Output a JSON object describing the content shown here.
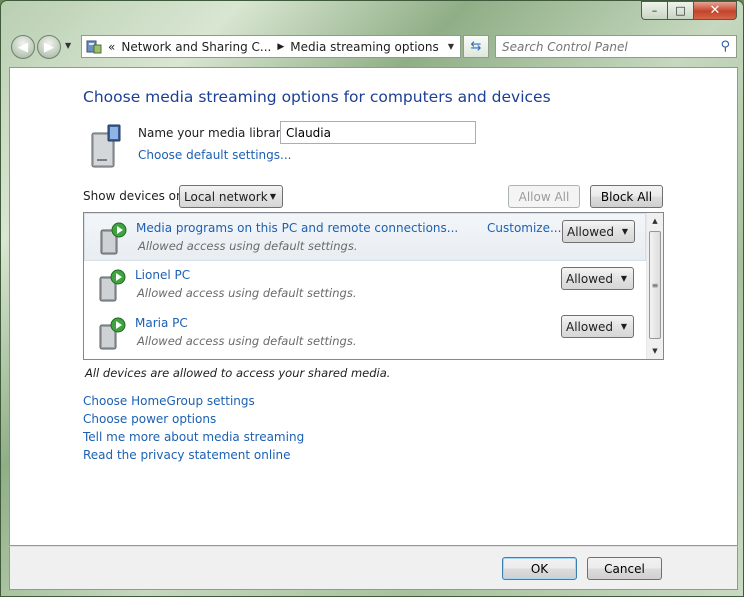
{
  "window": {
    "caption_buttons": {
      "minimize": "–",
      "maximize": "□",
      "close": "✕"
    }
  },
  "nav": {
    "back_icon": "back-arrow-icon",
    "forward_icon": "forward-arrow-icon",
    "breadcrumb_prefix": "«",
    "breadcrumbs": [
      "Network and Sharing C...",
      "Media streaming options"
    ],
    "search_placeholder": "Search Control Panel"
  },
  "main": {
    "title": "Choose media streaming options for computers and devices",
    "library_label": "Name your media library:",
    "library_name": "Claudia",
    "default_settings_link": "Choose default settings...",
    "show_devices_label": "Show devices on:",
    "show_devices_value": "Local network",
    "allow_all": "Allow All",
    "block_all": "Block All",
    "devices": [
      {
        "name": "Media programs on this PC and remote connections...",
        "status": "Allowed access using default settings.",
        "customize": "Customize...",
        "permission": "Allowed"
      },
      {
        "name": "Lionel PC",
        "status": "Allowed access using default settings.",
        "permission": "Allowed"
      },
      {
        "name": "Maria PC",
        "status": "Allowed access using default settings.",
        "permission": "Allowed"
      }
    ],
    "note": "All devices are allowed to access your shared media.",
    "links": [
      "Choose HomeGroup settings",
      "Choose power options",
      "Tell me more about media streaming",
      "Read the privacy statement online"
    ]
  },
  "footer": {
    "ok": "OK",
    "cancel": "Cancel"
  },
  "colors": {
    "link": "#1c60b3",
    "title": "#1c3f95",
    "status_text": "#6a6a6a"
  }
}
